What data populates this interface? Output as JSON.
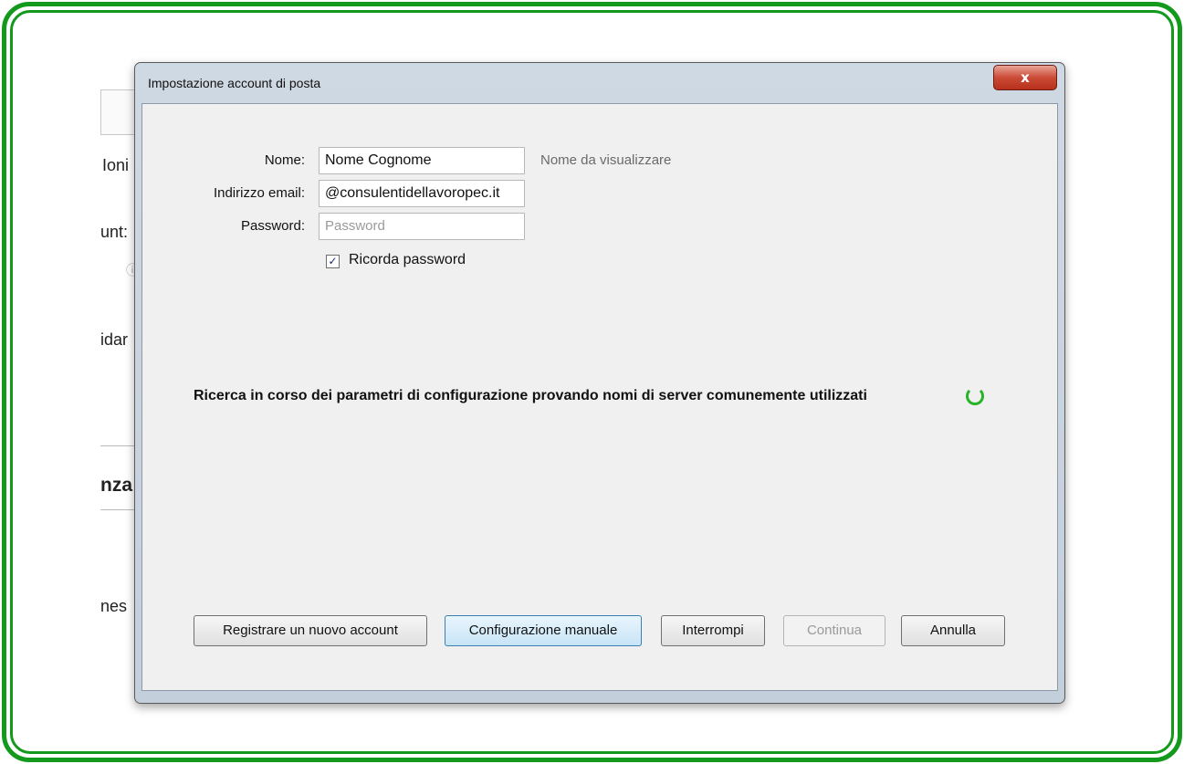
{
  "background_app": {
    "fragments": [
      "Ioni",
      "unt:",
      "idar",
      "nza",
      "nes"
    ]
  },
  "dialog": {
    "title": "Impostazione account di posta",
    "close_label": "x",
    "form": {
      "name_label": "Nome:",
      "name_value": "Nome Cognome",
      "name_hint": "Nome da visualizzare",
      "email_label": "Indirizzo email:",
      "email_value": "@consulentidellavoropec.it",
      "password_label": "Password:",
      "password_placeholder": "Password",
      "remember_label": "Ricorda password",
      "remember_checked": true
    },
    "status": {
      "text": "Ricerca in corso dei parametri di configurazione provando nomi di server comunemente utilizzati",
      "spinner_color": "#28b428"
    },
    "buttons": {
      "register": "Registrare un nuovo account",
      "manual": "Configurazione manuale",
      "stop": "Interrompi",
      "continue": "Continua",
      "cancel": "Annulla"
    }
  },
  "colors": {
    "frame": "#139a1c",
    "primary_button": "#c7e4f7",
    "close_button": "#cb4b36"
  }
}
